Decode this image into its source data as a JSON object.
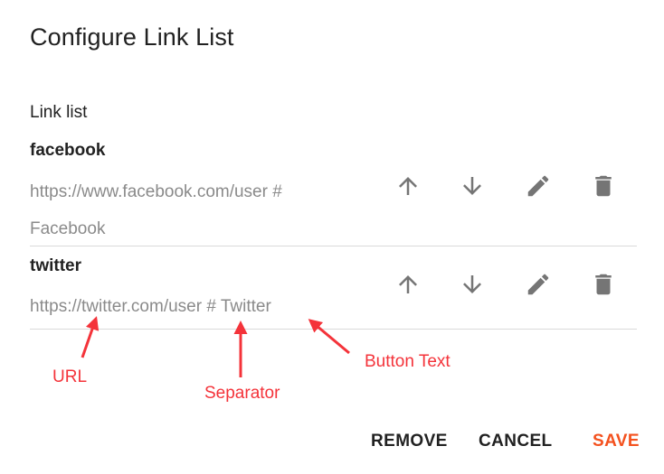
{
  "dialog": {
    "title": "Configure Link List",
    "section_label": "Link list"
  },
  "links": [
    {
      "name": "facebook",
      "value": "https://www.facebook.com/user # Facebook"
    },
    {
      "name": "twitter",
      "value": "https://twitter.com/user # Twitter"
    }
  ],
  "icons": {
    "move_up": "arrow-up-icon",
    "move_down": "arrow-down-icon",
    "edit": "pencil-icon",
    "delete": "trash-icon"
  },
  "annotations": {
    "url": "URL",
    "separator": "Separator",
    "button_text": "Button Text"
  },
  "actions": {
    "remove": "REMOVE",
    "cancel": "CANCEL",
    "save": "SAVE"
  },
  "colors": {
    "accent": "#f4511e",
    "annotation": "#f4333a",
    "icon": "#757575",
    "divider": "#d9d9d9"
  }
}
